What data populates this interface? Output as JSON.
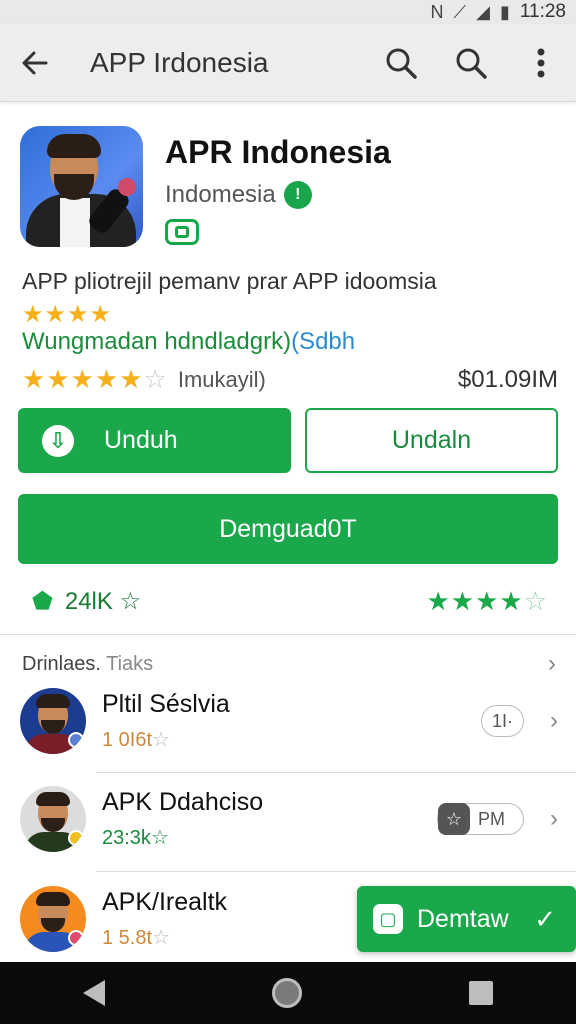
{
  "status_bar": {
    "time": "11:28",
    "icons": [
      "nfc-icon",
      "signal-icon",
      "wifi-icon",
      "battery-icon"
    ]
  },
  "appbar": {
    "title": "APP Irdonesia",
    "back_icon": "arrow-left-icon",
    "actions": [
      "search-icon",
      "search-icon",
      "more-vert-icon"
    ]
  },
  "app": {
    "name": "APR Indonesia",
    "developer": "Indomesia",
    "verified_glyph": "!",
    "description": "APP pliotrejil pemanv prar APP idoomsia",
    "small_stars": "★★★★",
    "tagline": "Wungmadan hdndladgrk)",
    "tagline_link": "(Sdbh",
    "rating_stars": "★★★★★",
    "rating_empty": "☆",
    "rating_label": "Imukayil)",
    "price": "$01.09IM"
  },
  "buttons": {
    "primary_label": "Unduh",
    "primary_icon_glyph": "⇩",
    "secondary_label": "Undaln",
    "wide_label": "Demguad0T"
  },
  "stats": {
    "left_icon_glyph": "⬟",
    "left_value": "24lK ☆",
    "right_stars": "★★★★",
    "right_empty": "☆"
  },
  "section": {
    "title": "Drinlaes.",
    "title_muted": "Tiaks",
    "chevron": "›"
  },
  "list": [
    {
      "title": "Pltil Séslvia",
      "sub": "1 0I6t",
      "sub_star": "☆",
      "pill": "1I·",
      "pill_icon": "",
      "avatar_body": "#7a1e2a",
      "avatar_bg": "#1b3c8f",
      "avatar_dot": "#5b7fd4"
    },
    {
      "title": "APK Ddahciso",
      "sub": "23:3k",
      "sub_star": "☆",
      "pill": "PM",
      "pill_icon": "☆",
      "avatar_body": "#243a1e",
      "avatar_bg": "#dcdcdc",
      "avatar_dot": "#f0c020"
    },
    {
      "title": "APK/Irealtk",
      "sub": "1 5.8t",
      "sub_star": "☆",
      "avatar_body": "#2a54b8",
      "avatar_bg": "#f58a1e",
      "avatar_dot": "#e04a6a"
    }
  ],
  "fab": {
    "label": "Demtaw",
    "icon_glyph": "▢",
    "check_glyph": "✓"
  },
  "colors": {
    "accent": "#1aa84a",
    "star": "#f5b01a"
  }
}
